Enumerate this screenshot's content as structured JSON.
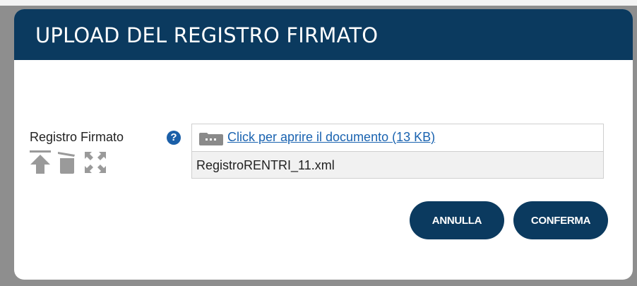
{
  "dialog": {
    "title": "UPLOAD DEL REGISTRO FIRMATO"
  },
  "field": {
    "label": "Registro Firmato",
    "help_glyph": "?",
    "link_text": "Click per aprire il documento (13 KB)",
    "file_name": "RegistroRENTRI_11.xml"
  },
  "icons": {
    "help": "help-icon",
    "upload": "upload-icon",
    "delete": "trash-icon",
    "fullscreen": "expand-icon",
    "folder": "folder-icon"
  },
  "buttons": {
    "cancel_label": "ANNULLA",
    "confirm_label": "CONFERMA"
  },
  "colors": {
    "header_bg": "#0b3a5f",
    "button_bg": "#0b3a5f",
    "link": "#1a63b0",
    "help_icon": "#1b5fa8",
    "tool_icon": "#9a9a9a"
  }
}
